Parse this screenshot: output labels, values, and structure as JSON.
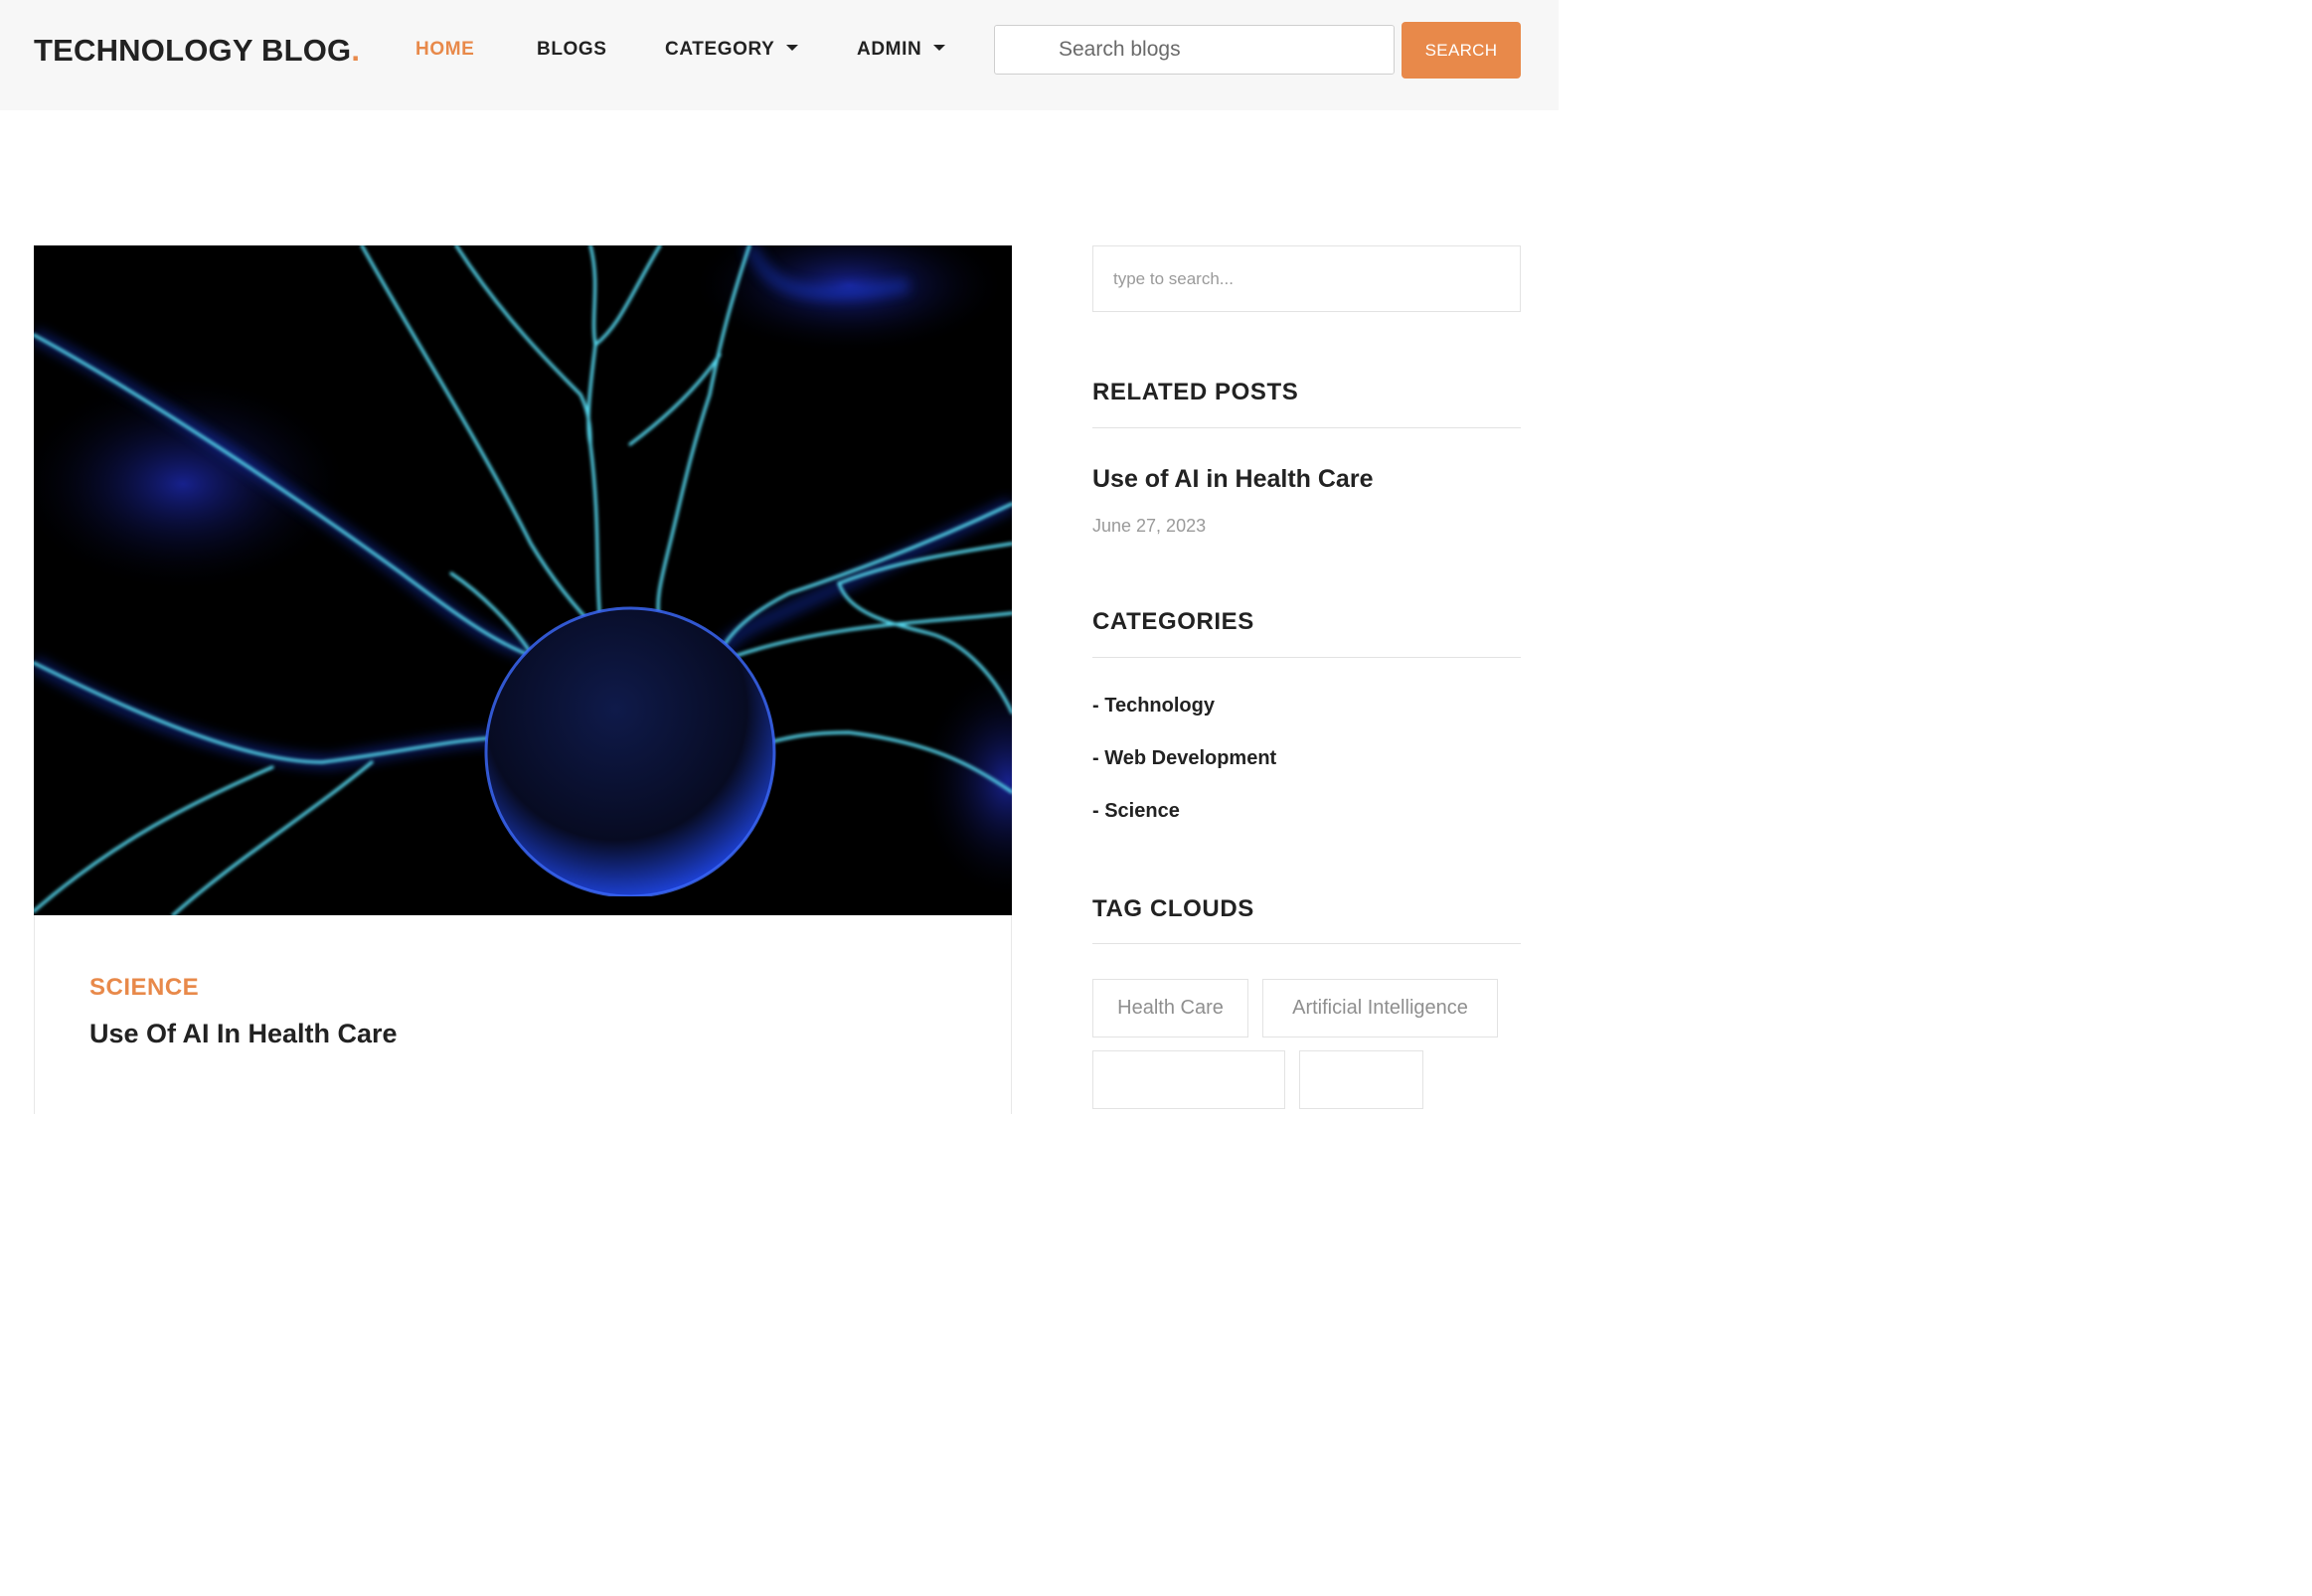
{
  "header": {
    "brand": "TECHNOLOGY BLOG",
    "brand_dot": ".",
    "nav": {
      "home": "HOME",
      "blogs": "BLOGS",
      "category": "CATEGORY",
      "admin": "ADMIN"
    },
    "search_placeholder": "Search blogs",
    "search_button": "SEARCH"
  },
  "post": {
    "category": "SCIENCE",
    "title": "Use Of AI In Health Care"
  },
  "sidebar": {
    "search_placeholder": "type to search...",
    "related": {
      "heading": "RELATED POSTS",
      "title": "Use of AI in Health Care",
      "date": "June 27, 2023"
    },
    "categories": {
      "heading": "CATEGORIES",
      "items": [
        "- Technology",
        "- Web Development",
        "- Science"
      ]
    },
    "tags": {
      "heading": "TAG CLOUDS",
      "items": [
        "Health Care",
        "Artificial Intelligence"
      ]
    }
  },
  "colors": {
    "accent": "#e8894a",
    "header_bg": "#f7f7f7",
    "text_dark": "#222222",
    "text_muted": "#9a9a9a"
  },
  "icons": [
    "caret-down-icon"
  ]
}
